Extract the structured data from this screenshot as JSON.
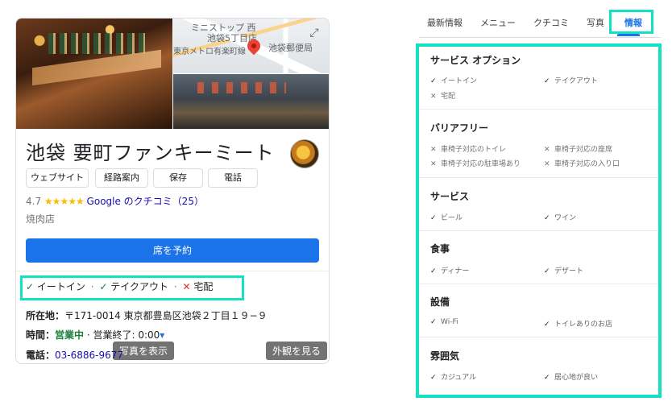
{
  "place": {
    "map_labels": [
      "ミニストップ 西",
      "池袋5丁目店",
      "東京メトロ有楽町線",
      "池袋郵便局"
    ],
    "photos_label": "写真を表示",
    "exterior_label": "外観を見る",
    "title": "池袋 要町ファンキーミート",
    "actions": [
      "ウェブサイト",
      "経路案内",
      "保存",
      "電話"
    ],
    "rating": "4.7",
    "stars": "★★★★★",
    "reviews_link": "Google のクチコミ（25）",
    "category": "焼肉店",
    "reserve_label": "席を予約"
  },
  "service_options": [
    {
      "mark": "✓",
      "label": "イートイン",
      "available": true
    },
    {
      "mark": "✓",
      "label": "テイクアウト",
      "available": true
    },
    {
      "mark": "✕",
      "label": "宅配",
      "available": false
    }
  ],
  "separator": "·",
  "info": {
    "address_label": "所在地：",
    "address_value": "〒171-0014 東京都豊島区池袋２丁目１９−９",
    "hours_label": "時間：",
    "hours_open": "営業中",
    "hours_rest": "· 営業終了: 0:00",
    "hours_caret": "▾",
    "phone_label": "電話：",
    "phone_value": "03-6886-9677"
  },
  "tabs": [
    "最新情報",
    "メニュー",
    "クチコミ",
    "写真",
    "情報"
  ],
  "active_tab": "情報",
  "sections": [
    {
      "title": "サービス オプション",
      "items": [
        {
          "mark": "✓",
          "label": "イートイン",
          "available": true
        },
        {
          "mark": "✓",
          "label": "テイクアウト",
          "available": true
        },
        {
          "mark": "✕",
          "label": "宅配",
          "available": false
        }
      ]
    },
    {
      "title": "バリアフリー",
      "items": [
        {
          "mark": "✕",
          "label": "車椅子対応のトイレ",
          "available": false
        },
        {
          "mark": "✕",
          "label": "車椅子対応の座席",
          "available": false
        },
        {
          "mark": "✕",
          "label": "車椅子対応の駐車場あり",
          "available": false
        },
        {
          "mark": "✕",
          "label": "車椅子対応の入り口",
          "available": false
        }
      ]
    },
    {
      "title": "サービス",
      "items": [
        {
          "mark": "✓",
          "label": "ビール",
          "available": true
        },
        {
          "mark": "✓",
          "label": "ワイン",
          "available": true
        }
      ]
    },
    {
      "title": "食事",
      "items": [
        {
          "mark": "✓",
          "label": "ディナー",
          "available": true
        },
        {
          "mark": "✓",
          "label": "デザート",
          "available": true
        }
      ]
    },
    {
      "title": "設備",
      "items": [
        {
          "mark": "✓",
          "label": "Wi-Fi",
          "available": true
        },
        {
          "mark": "✓",
          "label": "トイレありのお店",
          "available": true
        }
      ]
    },
    {
      "title": "雰囲気",
      "items": [
        {
          "mark": "✓",
          "label": "カジュアル",
          "available": true
        },
        {
          "mark": "✓",
          "label": "居心地が良い",
          "available": true
        }
      ]
    }
  ],
  "colors": {
    "highlight": "#14e0c4",
    "accent_blue": "#1a73e8",
    "open_green": "#188038",
    "unavailable_red": "#d93025",
    "star_yellow": "#fbbc04"
  }
}
